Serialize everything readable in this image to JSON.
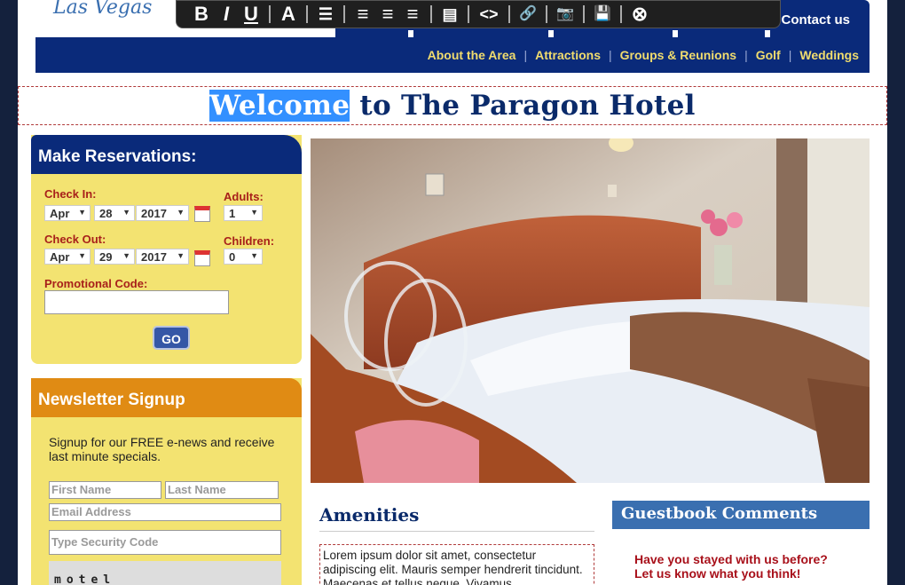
{
  "brand": {
    "logo_text": "Las Vegas"
  },
  "header": {
    "contact_label": "Contact us"
  },
  "nav": {
    "items": [
      "About the Area",
      "Attractions",
      "Groups & Reunions",
      "Golf",
      "Weddings"
    ]
  },
  "toolbar": {
    "buttons": [
      {
        "icon": "bold-icon",
        "glyph": "B"
      },
      {
        "icon": "italic-icon",
        "glyph": "I"
      },
      {
        "icon": "underline-icon",
        "glyph": "U"
      },
      {
        "icon": "font-color-icon",
        "glyph": "A"
      },
      {
        "icon": "bulleted-list-icon",
        "glyph": "☰"
      },
      {
        "icon": "align-left-icon",
        "glyph": "≡"
      },
      {
        "icon": "align-center-icon",
        "glyph": "≡"
      },
      {
        "icon": "align-right-icon",
        "glyph": "≡"
      },
      {
        "icon": "paragraph-format-icon",
        "glyph": "▤"
      },
      {
        "icon": "source-code-icon",
        "glyph": "<>"
      },
      {
        "icon": "link-icon",
        "glyph": "🔗"
      },
      {
        "icon": "insert-image-icon",
        "glyph": "📷"
      },
      {
        "icon": "save-icon",
        "glyph": "💾"
      },
      {
        "icon": "close-icon",
        "glyph": "⊗"
      }
    ]
  },
  "title": {
    "highlighted": "Welcome",
    "rest": " to The Paragon Hotel"
  },
  "reservations": {
    "heading": "Make Reservations:",
    "check_in_label": "Check In:",
    "check_in": {
      "month": "Apr",
      "day": "28",
      "year": "2017"
    },
    "check_out_label": "Check Out:",
    "check_out": {
      "month": "Apr",
      "day": "29",
      "year": "2017"
    },
    "adults_label": "Adults:",
    "adults": "1",
    "children_label": "Children:",
    "children": "0",
    "promo_label": "Promotional Code:",
    "promo_value": "",
    "go_label": "GO"
  },
  "newsletter": {
    "heading": "Newsletter Signup",
    "text": "Signup for our FREE e-news and receive last minute specials.",
    "first_name_placeholder": "First Name",
    "last_name_placeholder": "Last Name",
    "email_placeholder": "Email Address",
    "security_placeholder": "Type Security Code",
    "captcha_text": "motel"
  },
  "amenities": {
    "heading": "Amenities",
    "body": "Lorem ipsum dolor sit amet, consectetur adipiscing elit. Mauris semper hendrerit tincidunt. Maecenas et tellus neque. Vivamus"
  },
  "guestbook": {
    "heading": "Guestbook Comments",
    "line1": "Have you stayed with us before?",
    "line2": "Let us know what you think!"
  },
  "colors": {
    "navy": "#0a2a7a",
    "gold_text": "#f0dc6e",
    "panel_yellow": "#f3e371",
    "newsletter_orange": "#e08b14",
    "label_red": "#a8201a",
    "guestbook_blue": "#3a6fb0"
  }
}
